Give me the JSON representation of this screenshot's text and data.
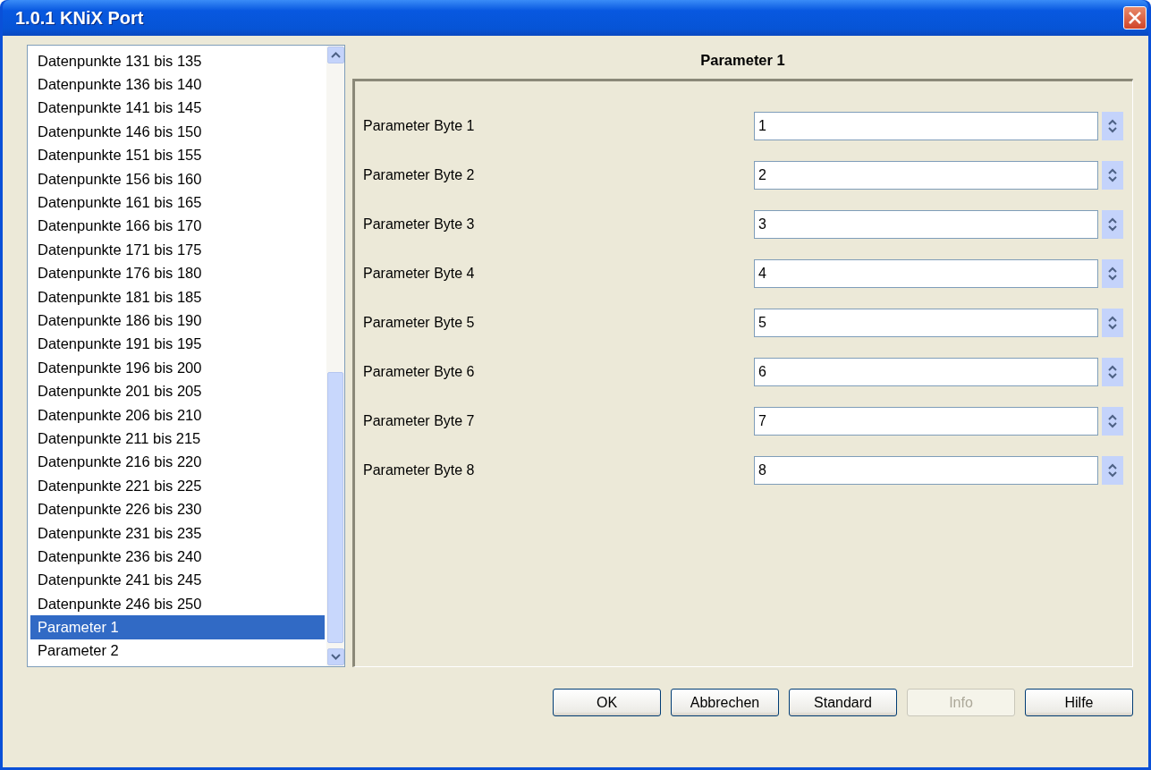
{
  "window": {
    "title": "1.0.1 KNiX Port"
  },
  "list": {
    "items": [
      {
        "label": "Datenpunkte 131 bis 135",
        "selected": false
      },
      {
        "label": "Datenpunkte 136 bis 140",
        "selected": false
      },
      {
        "label": "Datenpunkte 141 bis 145",
        "selected": false
      },
      {
        "label": "Datenpunkte 146 bis 150",
        "selected": false
      },
      {
        "label": "Datenpunkte 151 bis 155",
        "selected": false
      },
      {
        "label": "Datenpunkte 156 bis 160",
        "selected": false
      },
      {
        "label": "Datenpunkte 161 bis 165",
        "selected": false
      },
      {
        "label": "Datenpunkte 166 bis 170",
        "selected": false
      },
      {
        "label": "Datenpunkte 171 bis 175",
        "selected": false
      },
      {
        "label": "Datenpunkte 176 bis 180",
        "selected": false
      },
      {
        "label": "Datenpunkte 181 bis 185",
        "selected": false
      },
      {
        "label": "Datenpunkte 186 bis 190",
        "selected": false
      },
      {
        "label": "Datenpunkte 191 bis 195",
        "selected": false
      },
      {
        "label": "Datenpunkte 196 bis 200",
        "selected": false
      },
      {
        "label": "Datenpunkte 201 bis 205",
        "selected": false
      },
      {
        "label": "Datenpunkte 206 bis 210",
        "selected": false
      },
      {
        "label": "Datenpunkte 211 bis 215",
        "selected": false
      },
      {
        "label": "Datenpunkte 216 bis 220",
        "selected": false
      },
      {
        "label": "Datenpunkte 221 bis 225",
        "selected": false
      },
      {
        "label": "Datenpunkte 226 bis 230",
        "selected": false
      },
      {
        "label": "Datenpunkte 231 bis 235",
        "selected": false
      },
      {
        "label": "Datenpunkte 236 bis 240",
        "selected": false
      },
      {
        "label": "Datenpunkte 241 bis 245",
        "selected": false
      },
      {
        "label": "Datenpunkte 246 bis 250",
        "selected": false
      },
      {
        "label": "Parameter 1",
        "selected": true
      },
      {
        "label": "Parameter 2",
        "selected": false
      }
    ]
  },
  "panel": {
    "title": "Parameter 1",
    "fields": [
      {
        "label": "Parameter Byte 1",
        "value": "1"
      },
      {
        "label": "Parameter Byte 2",
        "value": "2"
      },
      {
        "label": "Parameter Byte 3",
        "value": "3"
      },
      {
        "label": "Parameter Byte 4",
        "value": "4"
      },
      {
        "label": "Parameter Byte 5",
        "value": "5"
      },
      {
        "label": "Parameter Byte 6",
        "value": "6"
      },
      {
        "label": "Parameter Byte 7",
        "value": "7"
      },
      {
        "label": "Parameter Byte 8",
        "value": "8"
      }
    ]
  },
  "buttons": [
    {
      "label": "OK",
      "disabled": false
    },
    {
      "label": "Abbrechen",
      "disabled": false
    },
    {
      "label": "Standard",
      "disabled": false
    },
    {
      "label": "Info",
      "disabled": true
    },
    {
      "label": "Hilfe",
      "disabled": false
    }
  ]
}
